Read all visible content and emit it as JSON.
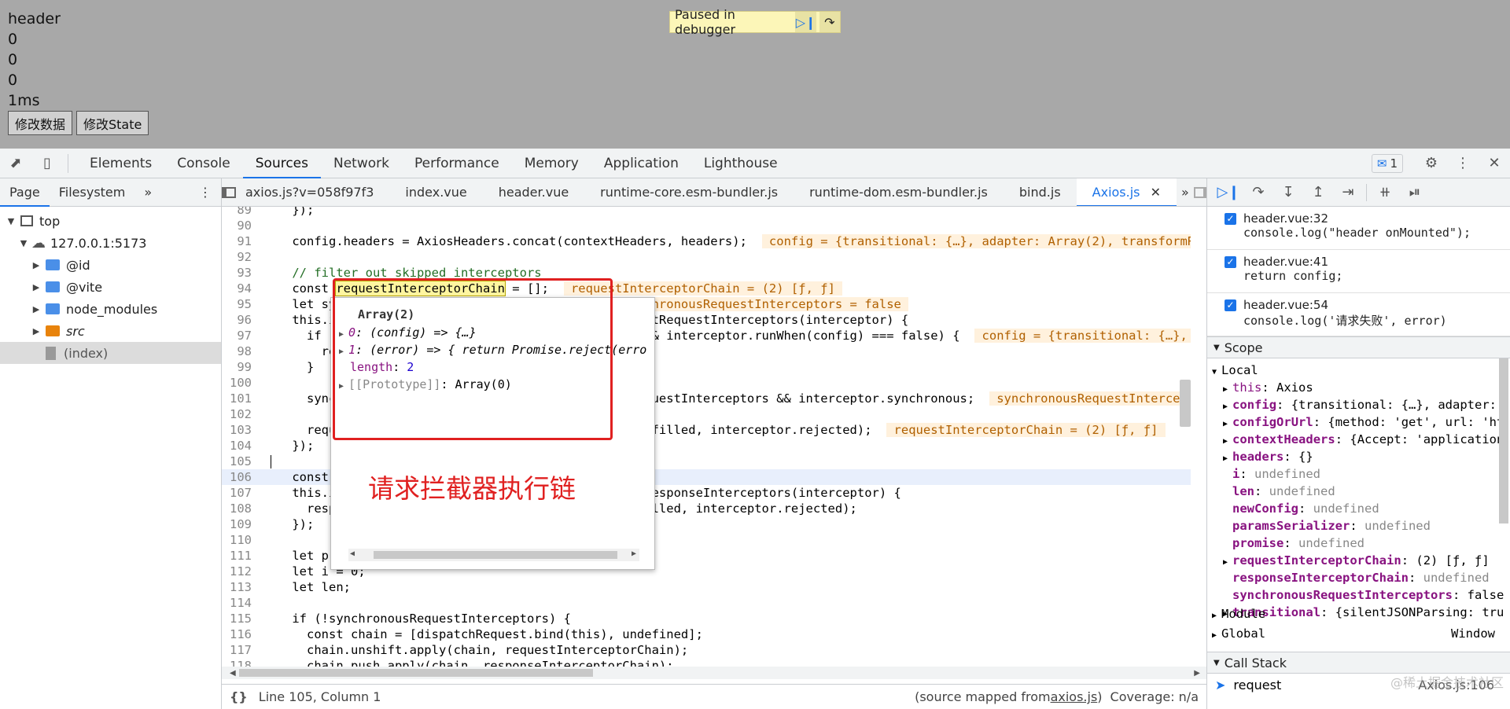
{
  "page": {
    "lines": [
      "header",
      "0",
      "0",
      "0",
      "1ms"
    ],
    "buttons": [
      "修改数据",
      "修改State"
    ],
    "paused_label": "Paused in debugger"
  },
  "toolbar": {
    "tabs": [
      "Elements",
      "Console",
      "Sources",
      "Network",
      "Performance",
      "Memory",
      "Application",
      "Lighthouse"
    ],
    "active_tab": "Sources",
    "issues_count": "1"
  },
  "navigator": {
    "tabs": [
      "Page",
      "Filesystem"
    ],
    "tree": [
      {
        "label": "top",
        "type": "frame"
      },
      {
        "label": "127.0.0.1:5173",
        "type": "origin"
      },
      {
        "label": "@id",
        "type": "folder"
      },
      {
        "label": "@vite",
        "type": "folder"
      },
      {
        "label": "node_modules",
        "type": "folder"
      },
      {
        "label": "src",
        "type": "folder-src"
      },
      {
        "label": "(index)",
        "type": "file"
      }
    ]
  },
  "editor": {
    "tabs": [
      "axios.js?v=058f97f3",
      "index.vue",
      "header.vue",
      "runtime-core.esm-bundler.js",
      "runtime-dom.esm-bundler.js",
      "bind.js",
      "Axios.js"
    ],
    "active_tab": "Axios.js",
    "lines": [
      {
        "n": "89",
        "t": "    });"
      },
      {
        "n": "90",
        "t": ""
      },
      {
        "n": "91",
        "t": "    config.headers = AxiosHeaders.concat(contextHeaders, headers);",
        "i": "config = {transitional: {…}, adapter: Array(2), transformRequ"
      },
      {
        "n": "92",
        "t": ""
      },
      {
        "n": "93",
        "t": "    // filter out skipped interceptors"
      },
      {
        "n": "94",
        "t": "    const ",
        "hl": "requestInterceptorChain",
        "t2": " = [];",
        "i": "requestInterceptorChain = (2) [ƒ, ƒ]"
      },
      {
        "n": "95",
        "t": "    let synchronousRequestInterceptors = true;",
        "i": "synchronousRequestInterceptors = false"
      },
      {
        "n": "96",
        "t": "    this.interceptors.request.forEach(function unshiftRequestInterceptors(interceptor) {"
      },
      {
        "n": "97",
        "t": "      if (typeof interceptor.runWhen === 'function' && interceptor.runWhen(config) === false) {",
        "i": "config = {transitional: {…}, ada"
      },
      {
        "n": "98",
        "t": "        return;"
      },
      {
        "n": "99",
        "t": "      }"
      },
      {
        "n": "100",
        "t": ""
      },
      {
        "n": "101",
        "t": "      synchronousRequestInterceptors = synchronousRequestInterceptors && interceptor.synchronous;",
        "i": "synchronousRequestInterceptors"
      },
      {
        "n": "102",
        "t": ""
      },
      {
        "n": "103",
        "t": "      requestInterceptorChain.unshift(interceptor.fulfilled, interceptor.rejected);",
        "i": "requestInterceptorChain = (2) [ƒ, ƒ]"
      },
      {
        "n": "104",
        "t": "    });"
      },
      {
        "n": "105",
        "t": ""
      },
      {
        "n": "106",
        "t": "    const responseInterceptorChain = [];"
      },
      {
        "n": "107",
        "t": "    this.interceptors.response.forEach(function pushResponseInterceptors(interceptor) {"
      },
      {
        "n": "108",
        "t": "      responseInterceptorChain.push(interceptor.fulfilled, interceptor.rejected);"
      },
      {
        "n": "109",
        "t": "    });"
      },
      {
        "n": "110",
        "t": ""
      },
      {
        "n": "111",
        "t": "    let promise;"
      },
      {
        "n": "112",
        "t": "    let i = 0;"
      },
      {
        "n": "113",
        "t": "    let len;"
      },
      {
        "n": "114",
        "t": ""
      },
      {
        "n": "115",
        "t": "    if (!synchronousRequestInterceptors) {"
      },
      {
        "n": "116",
        "t": "      const chain = [dispatchRequest.bind(this), undefined];"
      },
      {
        "n": "117",
        "t": "      chain.unshift.apply(chain, requestInterceptorChain);"
      },
      {
        "n": "118",
        "t": "      chain.push.apply(chain, responseInterceptorChain);"
      }
    ],
    "status_position": "Line 105, Column 1",
    "status_source_prefix": "(source mapped from ",
    "status_source_link": "axios.js",
    "status_source_suffix": ")",
    "status_coverage": "Coverage: n/a"
  },
  "popover": {
    "title": "Array(2)",
    "rows": [
      {
        "k": "0",
        "v": " (config) => {…}"
      },
      {
        "k": "1",
        "v": " (error) => { return Promise.reject(erro"
      },
      {
        "k": "length",
        "v": " 2"
      },
      {
        "k": "[[Prototype]]",
        "v": " Array(0)"
      }
    ]
  },
  "annotation": "请求拦截器执行链",
  "breakpoints": [
    {
      "file": "header.vue:32",
      "code": "console.log(\"header onMounted\");"
    },
    {
      "file": "header.vue:41",
      "code": "return config;"
    },
    {
      "file": "header.vue:54",
      "code": "console.log('请求失败', error)"
    }
  ],
  "scope": {
    "title": "Scope",
    "local_label": "Local",
    "vars": [
      {
        "k": "this",
        "v": "Axios",
        "exp": true
      },
      {
        "k": "config",
        "v": "{transitional: {…}, adapter: ",
        "exp": true
      },
      {
        "k": "configOrUrl",
        "v": "{method: 'get', url: 'ht",
        "exp": true
      },
      {
        "k": "contextHeaders",
        "v": "{Accept: 'application",
        "exp": true
      },
      {
        "k": "headers",
        "v": "{}",
        "exp": true
      },
      {
        "k": "i",
        "v": "undefined",
        "exp": false
      },
      {
        "k": "len",
        "v": "undefined",
        "exp": false
      },
      {
        "k": "newConfig",
        "v": "undefined",
        "exp": false
      },
      {
        "k": "paramsSerializer",
        "v": "undefined",
        "exp": false
      },
      {
        "k": "promise",
        "v": "undefined",
        "exp": false
      },
      {
        "k": "requestInterceptorChain",
        "v": "(2) [ƒ, ƒ]",
        "exp": true
      },
      {
        "k": "responseInterceptorChain",
        "v": "undefined",
        "exp": false
      },
      {
        "k": "synchronousRequestInterceptors",
        "v": "false",
        "exp": false
      },
      {
        "k": "transitional",
        "v": "{silentJSONParsing: tru",
        "exp": true
      }
    ],
    "module_label": "Module",
    "global_label": "Global",
    "global_value": "Window"
  },
  "callstack": {
    "title": "Call Stack",
    "frame": "request",
    "location": "Axios.js:106"
  },
  "watermark": "@稀土掘金技术社区"
}
